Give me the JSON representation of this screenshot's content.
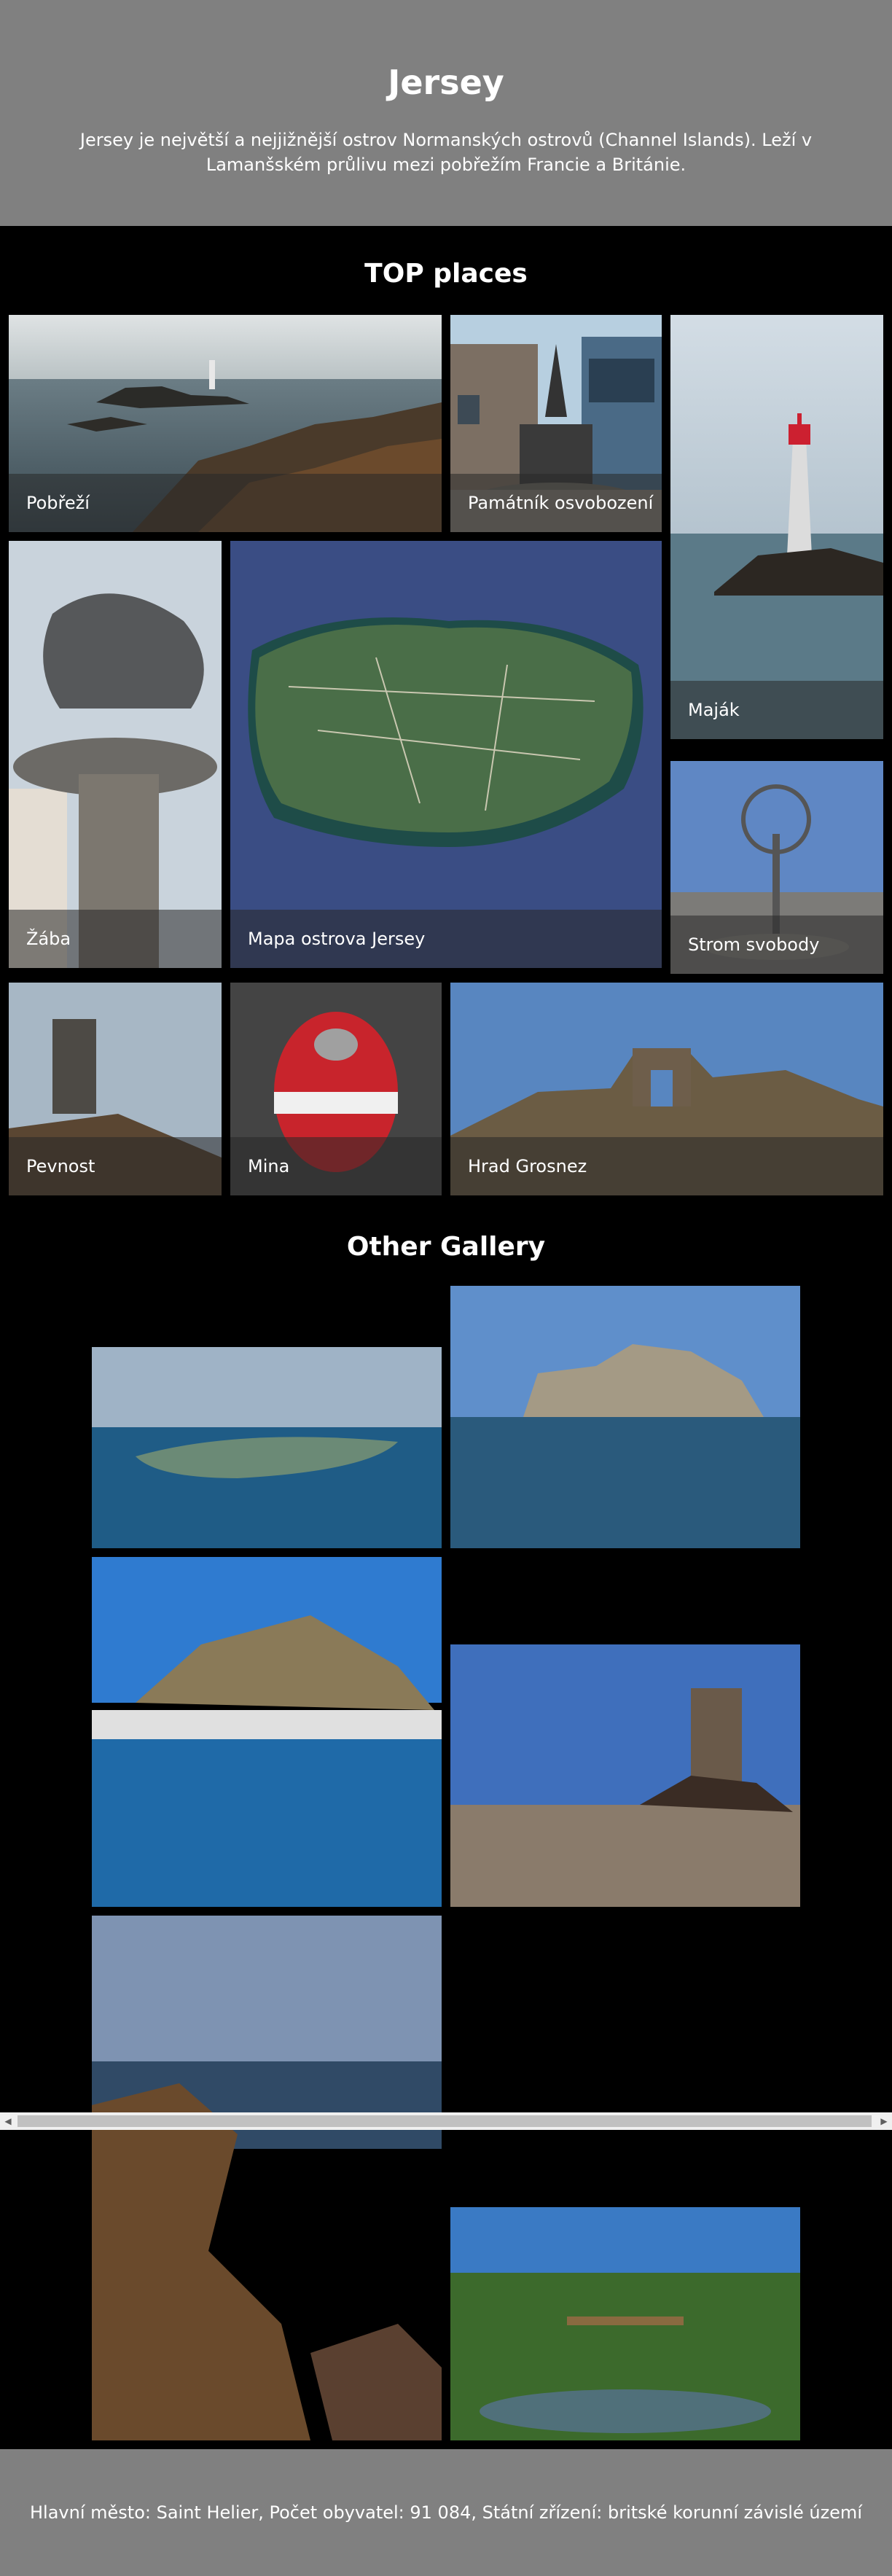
{
  "header": {
    "title": "Jersey",
    "description": "Jersey je největší a nejjižnější ostrov Normanských ostrovů (Channel Islands). Leží v Lamanšském průlivu mezi pobřežím Francie a Británie."
  },
  "top_places": {
    "title": "TOP places",
    "items": [
      {
        "caption": "Pobřeží"
      },
      {
        "caption": "Památník osvobození"
      },
      {
        "caption": "Maják"
      },
      {
        "caption": "Žába"
      },
      {
        "caption": "Mapa ostrova Jersey"
      },
      {
        "caption": "Strom svobody"
      },
      {
        "caption": "Pevnost"
      },
      {
        "caption": "Mina"
      },
      {
        "caption": "Hrad Grosnez"
      }
    ]
  },
  "gallery": {
    "title": "Other Gallery"
  },
  "scrollbar": {
    "left_arrow": "◀",
    "right_arrow": "▶"
  },
  "footer": {
    "text": "Hlavní město: Saint Helier, Počet obyvatel: 91 084, Státní zřízení: britské korunní závislé území"
  }
}
